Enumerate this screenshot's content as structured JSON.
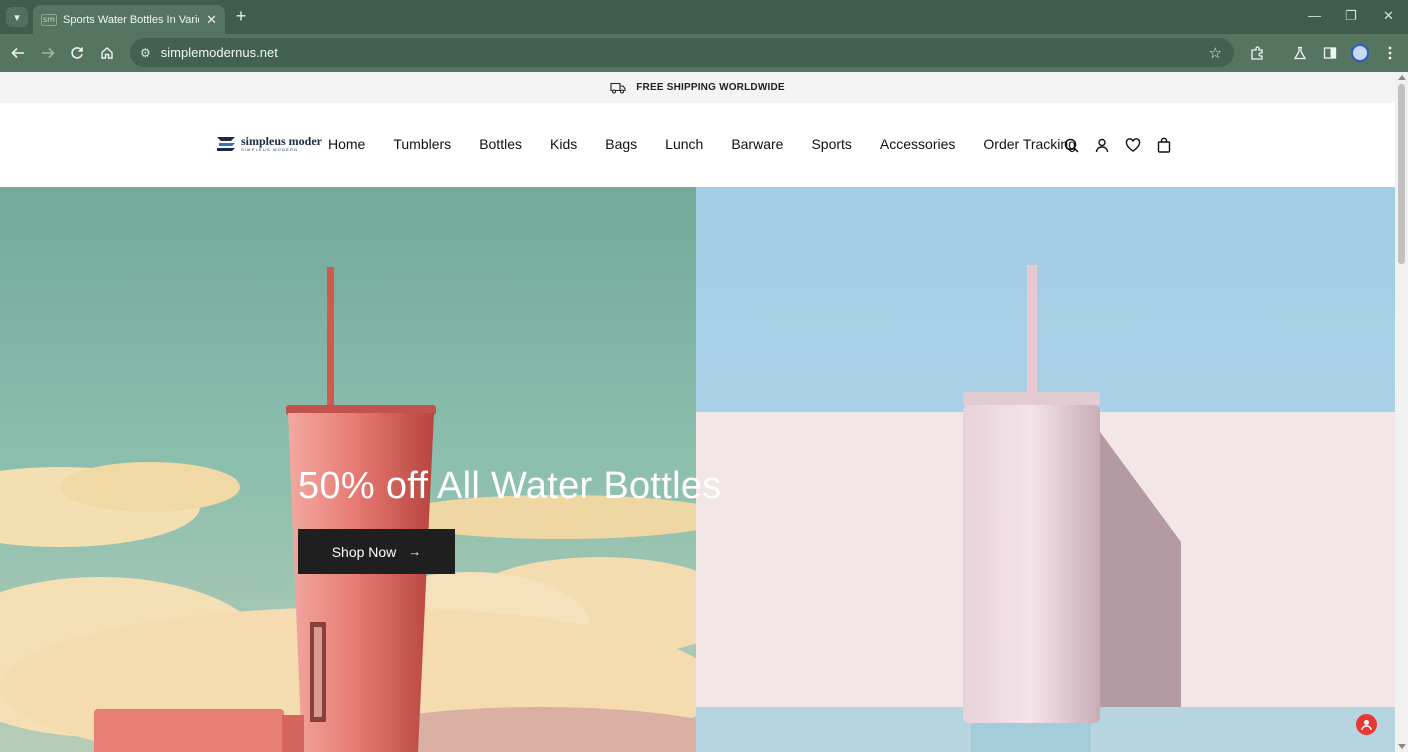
{
  "browser": {
    "tab_title": "Sports Water Bottles In Various",
    "tab_favicon": "sm",
    "url": "simplemodernus.net"
  },
  "announcement": {
    "text": "FREE SHIPPING WORLDWIDE",
    "icon": "truck-icon"
  },
  "header": {
    "logo_name": "simpleus moder",
    "logo_sub": "SIMPLEUS MODERN",
    "nav": [
      "Home",
      "Tumblers",
      "Bottles",
      "Kids",
      "Bags",
      "Lunch",
      "Barware",
      "Sports",
      "Accessories",
      "Order Tracking"
    ],
    "icons": [
      "search-icon",
      "account-icon",
      "wishlist-icon",
      "cart-icon"
    ]
  },
  "hero": {
    "title": "50% off All Water Bottles",
    "button_label": "Shop Now",
    "button_arrow": "→"
  },
  "colors": {
    "chrome_dark": "#3f5d4c",
    "chrome": "#557560",
    "button": "#1f1f1f",
    "tumbler": "#e57670",
    "sky_left": "#7fb4a6",
    "sky_right": "#a9d1e6"
  }
}
